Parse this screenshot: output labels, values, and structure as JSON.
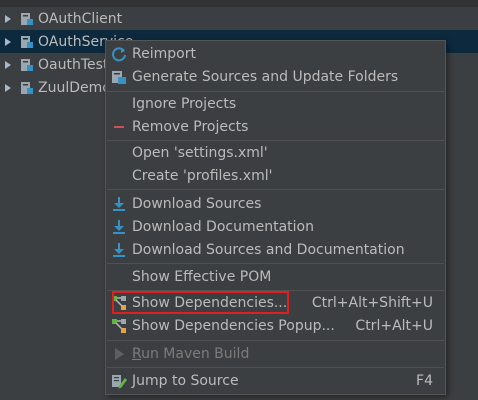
{
  "tree": {
    "items": [
      {
        "label": "OAuthClient",
        "selected": false
      },
      {
        "label": "OAuthService",
        "selected": true
      },
      {
        "label": "OauthTest",
        "selected": false
      },
      {
        "label": "ZuulDemo",
        "selected": false
      }
    ]
  },
  "menu": {
    "reimport": "Reimport",
    "generate_sources": "Generate Sources and Update Folders",
    "ignore_projects": "Ignore Projects",
    "remove_projects": "Remove Projects",
    "open_settings": "Open 'settings.xml'",
    "create_profiles": "Create 'profiles.xml'",
    "download_sources": "Download Sources",
    "download_documentation": "Download Documentation",
    "download_sources_and_documentation": "Download Sources and Documentation",
    "show_effective_pom": "Show Effective POM",
    "show_dependencies": "Show Dependencies...",
    "show_dependencies_shortcut": "Ctrl+Alt+Shift+U",
    "show_dependencies_popup": "Show Dependencies Popup...",
    "show_dependencies_popup_shortcut": "Ctrl+Alt+U",
    "run_maven_build_mnemonic": "R",
    "run_maven_build_rest": "un Maven Build",
    "jump_to_source": "Jump to Source",
    "jump_to_source_shortcut": "F4"
  },
  "colors": {
    "background": "#3c3f41",
    "menu_text": "#bbbbbb",
    "disabled_text": "#7b7b7b",
    "selection": "#0d293e",
    "highlight_border": "#e02020",
    "icon_blue": "#3592c4",
    "icon_red": "#c75450"
  },
  "icons": {
    "reimport": "refresh-icon",
    "generate_sources": "generate-sources-icon",
    "remove_projects": "minus-icon",
    "download": "download-icon",
    "dependencies": "diagram-icon",
    "run": "run-icon",
    "jump_to_source": "edit-source-icon"
  }
}
